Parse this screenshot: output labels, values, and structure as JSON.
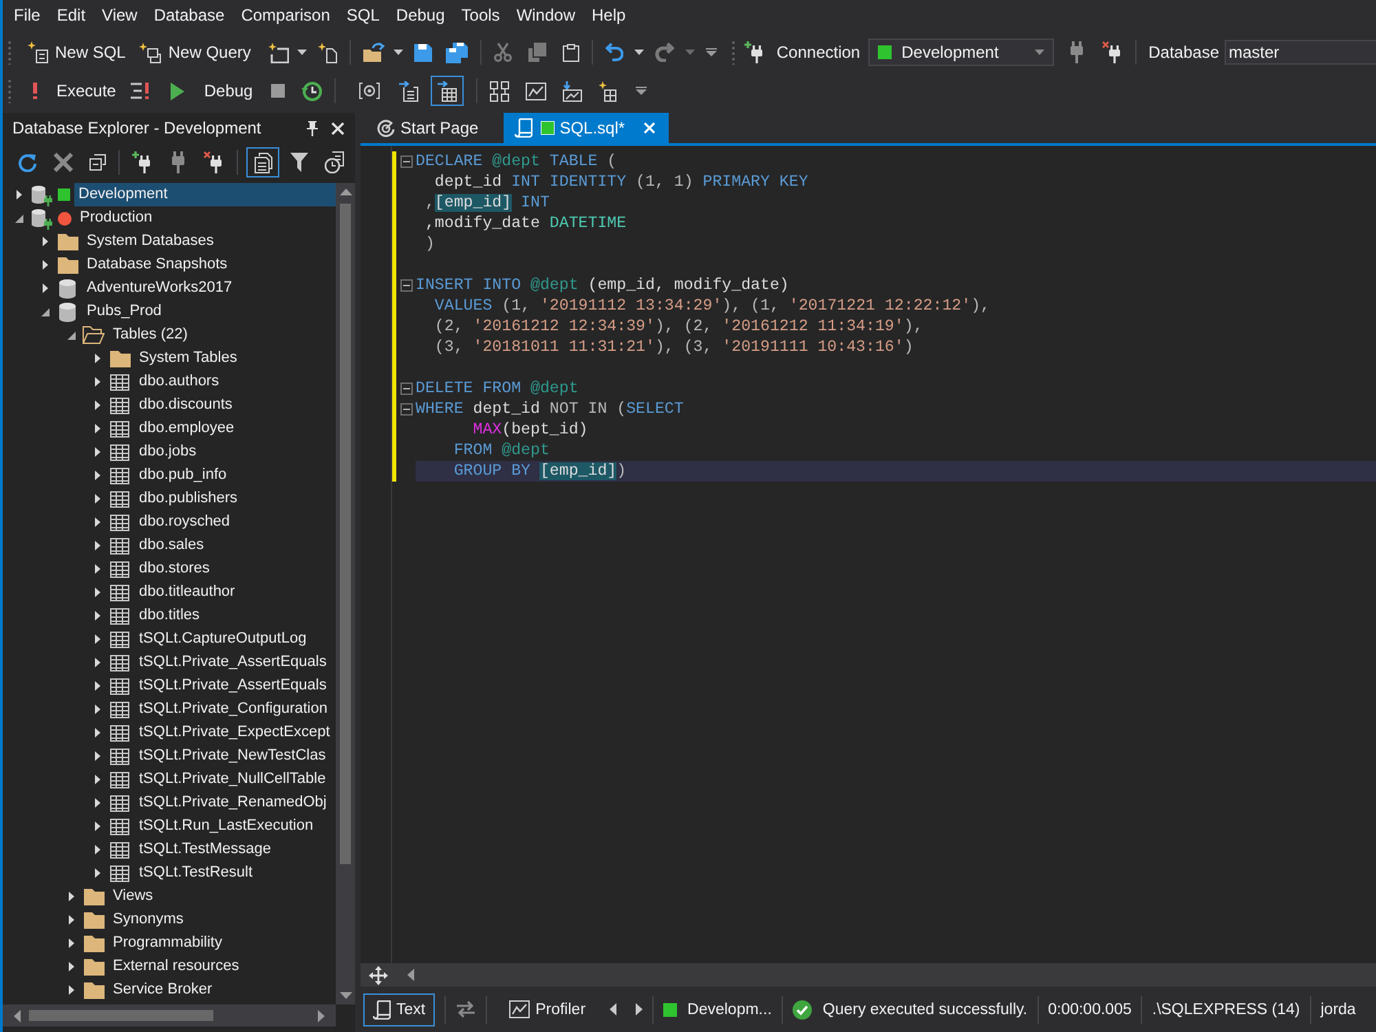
{
  "menu": [
    "File",
    "Edit",
    "View",
    "Database",
    "Comparison",
    "SQL",
    "Debug",
    "Tools",
    "Window",
    "Help"
  ],
  "toolbar_main": {
    "new_sql": "New SQL",
    "new_query": "New Query",
    "cut": {
      "disabled": true
    },
    "copy": {
      "disabled": true
    },
    "undo": {
      "disabled": false
    },
    "redo": {
      "disabled": true
    },
    "connection_label": "Connection",
    "connection": {
      "value": "Development",
      "color": "#2fc42f"
    },
    "database_label": "Database",
    "database": {
      "value": "master"
    }
  },
  "toolbar_query": {
    "execute": "Execute",
    "debug": "Debug",
    "view_toggles": [
      {
        "pressed": false
      },
      {
        "pressed": false
      },
      {
        "pressed": true
      }
    ]
  },
  "explorer": {
    "title": "Database Explorer - Development",
    "toolbar_toggle": {
      "pressed": true
    },
    "tree": [
      {
        "label": "Development",
        "kind": "server",
        "status_dot": false,
        "color": "#2fc42f",
        "expanded": false,
        "selected": true
      },
      {
        "label": "Production",
        "kind": "server",
        "status_dot": true,
        "color": "#f2553f",
        "expanded": true,
        "selected": false,
        "children": [
          {
            "label": "System Databases",
            "kind": "folder",
            "expanded": false,
            "selected": false
          },
          {
            "label": "Database Snapshots",
            "kind": "folder",
            "expanded": false,
            "selected": false
          },
          {
            "label": "AdventureWorks2017",
            "kind": "database",
            "expanded": false,
            "selected": false
          },
          {
            "label": "Pubs_Prod",
            "kind": "database",
            "expanded": true,
            "selected": false,
            "children": [
              {
                "label": "Tables (22)",
                "kind": "folder",
                "expanded": true,
                "selected": false,
                "children": [
                  {
                    "label": "System Tables",
                    "kind": "folder",
                    "expanded": false,
                    "selected": false
                  },
                  {
                    "label": "dbo.authors",
                    "kind": "table",
                    "expanded": false,
                    "selected": false
                  },
                  {
                    "label": "dbo.discounts",
                    "kind": "table",
                    "expanded": false,
                    "selected": false
                  },
                  {
                    "label": "dbo.employee",
                    "kind": "table",
                    "expanded": false,
                    "selected": false
                  },
                  {
                    "label": "dbo.jobs",
                    "kind": "table",
                    "expanded": false,
                    "selected": false
                  },
                  {
                    "label": "dbo.pub_info",
                    "kind": "table",
                    "expanded": false,
                    "selected": false
                  },
                  {
                    "label": "dbo.publishers",
                    "kind": "table",
                    "expanded": false,
                    "selected": false
                  },
                  {
                    "label": "dbo.roysched",
                    "kind": "table",
                    "expanded": false,
                    "selected": false
                  },
                  {
                    "label": "dbo.sales",
                    "kind": "table",
                    "expanded": false,
                    "selected": false
                  },
                  {
                    "label": "dbo.stores",
                    "kind": "table",
                    "expanded": false,
                    "selected": false
                  },
                  {
                    "label": "dbo.titleauthor",
                    "kind": "table",
                    "expanded": false,
                    "selected": false
                  },
                  {
                    "label": "dbo.titles",
                    "kind": "table",
                    "expanded": false,
                    "selected": false
                  },
                  {
                    "label": "tSQLt.CaptureOutputLog",
                    "kind": "table",
                    "expanded": false,
                    "selected": false
                  },
                  {
                    "label": "tSQLt.Private_AssertEquals",
                    "kind": "table",
                    "expanded": false,
                    "selected": false
                  },
                  {
                    "label": "tSQLt.Private_AssertEquals",
                    "kind": "table",
                    "expanded": false,
                    "selected": false
                  },
                  {
                    "label": "tSQLt.Private_Configuration",
                    "kind": "table",
                    "expanded": false,
                    "selected": false
                  },
                  {
                    "label": "tSQLt.Private_ExpectExcept",
                    "kind": "table",
                    "expanded": false,
                    "selected": false
                  },
                  {
                    "label": "tSQLt.Private_NewTestClas",
                    "kind": "table",
                    "expanded": false,
                    "selected": false
                  },
                  {
                    "label": "tSQLt.Private_NullCellTable",
                    "kind": "table",
                    "expanded": false,
                    "selected": false
                  },
                  {
                    "label": "tSQLt.Private_RenamedObj",
                    "kind": "table",
                    "expanded": false,
                    "selected": false
                  },
                  {
                    "label": "tSQLt.Run_LastExecution",
                    "kind": "table",
                    "expanded": false,
                    "selected": false
                  },
                  {
                    "label": "tSQLt.TestMessage",
                    "kind": "table",
                    "expanded": false,
                    "selected": false
                  },
                  {
                    "label": "tSQLt.TestResult",
                    "kind": "table",
                    "expanded": false,
                    "selected": false
                  }
                ]
              },
              {
                "label": "Views",
                "kind": "folder",
                "expanded": false,
                "selected": false
              },
              {
                "label": "Synonyms",
                "kind": "folder",
                "expanded": false,
                "selected": false
              },
              {
                "label": "Programmability",
                "kind": "folder",
                "expanded": false,
                "selected": false
              },
              {
                "label": "External resources",
                "kind": "folder",
                "expanded": false,
                "selected": false
              },
              {
                "label": "Service Broker",
                "kind": "folder",
                "expanded": false,
                "selected": false
              }
            ]
          }
        ]
      }
    ]
  },
  "editor": {
    "tabs": [
      {
        "label": "Start Page",
        "kind": "start",
        "selected": false
      },
      {
        "label": "SQL.sql*",
        "kind": "sql",
        "selected": true,
        "color": "#2fc42f"
      }
    ],
    "lines": [
      {
        "changed": true,
        "fold": true,
        "current": false,
        "tokens": [
          {
            "text": "DECLARE ",
            "kind": "keyword"
          },
          {
            "text": "@dept ",
            "kind": "variable"
          },
          {
            "text": "TABLE",
            "kind": "keyword"
          },
          {
            "text": " (",
            "kind": "punct"
          }
        ]
      },
      {
        "changed": true,
        "fold": false,
        "current": false,
        "tokens": [
          {
            "text": "  dept_id ",
            "kind": "plain"
          },
          {
            "text": "INT IDENTITY",
            "kind": "keyword"
          },
          {
            "text": " (1, 1) ",
            "kind": "punct"
          },
          {
            "text": "PRIMARY KEY",
            "kind": "keyword"
          }
        ]
      },
      {
        "changed": true,
        "fold": false,
        "current": false,
        "tokens": [
          {
            "text": " ,",
            "kind": "punct"
          },
          {
            "text": "[emp_id]",
            "kind": "match"
          },
          {
            "text": " INT",
            "kind": "keyword"
          }
        ]
      },
      {
        "changed": true,
        "fold": false,
        "current": false,
        "tokens": [
          {
            "text": " ,modify_date ",
            "kind": "plain"
          },
          {
            "text": "DATETIME",
            "kind": "type"
          }
        ]
      },
      {
        "changed": true,
        "fold": false,
        "current": false,
        "tokens": [
          {
            "text": " )",
            "kind": "punct"
          }
        ]
      },
      {
        "changed": true,
        "fold": false,
        "current": false
      },
      {
        "changed": true,
        "fold": true,
        "current": false,
        "tokens": [
          {
            "text": "INSERT INTO ",
            "kind": "keyword"
          },
          {
            "text": "@dept",
            "kind": "variable"
          },
          {
            "text": " (emp_id, modify_date)",
            "kind": "plain"
          }
        ]
      },
      {
        "changed": true,
        "fold": false,
        "current": false,
        "tokens": [
          {
            "text": "  VALUES",
            "kind": "keyword"
          },
          {
            "text": " (1, ",
            "kind": "punct"
          },
          {
            "text": "'20191112 13:34:29'",
            "kind": "string"
          },
          {
            "text": "), (1, ",
            "kind": "punct"
          },
          {
            "text": "'20171221 12:22:12'",
            "kind": "string"
          },
          {
            "text": "),",
            "kind": "punct"
          }
        ]
      },
      {
        "changed": true,
        "fold": false,
        "current": false,
        "tokens": [
          {
            "text": "  (2, ",
            "kind": "punct"
          },
          {
            "text": "'20161212 12:34:39'",
            "kind": "string"
          },
          {
            "text": "), (2, ",
            "kind": "punct"
          },
          {
            "text": "'20161212 11:34:19'",
            "kind": "string"
          },
          {
            "text": "),",
            "kind": "punct"
          }
        ]
      },
      {
        "changed": true,
        "fold": false,
        "current": false,
        "tokens": [
          {
            "text": "  (3, ",
            "kind": "punct"
          },
          {
            "text": "'20181011 11:31:21'",
            "kind": "string"
          },
          {
            "text": "), (3, ",
            "kind": "punct"
          },
          {
            "text": "'20191111 10:43:16'",
            "kind": "string"
          },
          {
            "text": ")",
            "kind": "punct"
          }
        ]
      },
      {
        "changed": true,
        "fold": false,
        "current": false
      },
      {
        "changed": true,
        "fold": true,
        "current": false,
        "tokens": [
          {
            "text": "DELETE FROM ",
            "kind": "keyword"
          },
          {
            "text": "@dept",
            "kind": "variable"
          }
        ]
      },
      {
        "changed": true,
        "fold": true,
        "current": false,
        "tokens": [
          {
            "text": "WHERE",
            "kind": "keyword"
          },
          {
            "text": " dept_id ",
            "kind": "plain"
          },
          {
            "text": "NOT IN (",
            "kind": "punct"
          },
          {
            "text": "SELECT",
            "kind": "keyword"
          }
        ]
      },
      {
        "changed": true,
        "fold": false,
        "current": false,
        "tokens": [
          {
            "text": "      MAX",
            "kind": "function"
          },
          {
            "text": "(bept_id)",
            "kind": "plain"
          }
        ]
      },
      {
        "changed": true,
        "fold": false,
        "current": false,
        "tokens": [
          {
            "text": "    FROM ",
            "kind": "keyword"
          },
          {
            "text": "@dept",
            "kind": "variable"
          }
        ]
      },
      {
        "changed": true,
        "fold": false,
        "current": true,
        "tokens": [
          {
            "text": "    GROUP BY ",
            "kind": "keyword"
          },
          {
            "text": "[emp_id]",
            "kind": "match"
          },
          {
            "text": ")",
            "kind": "punct"
          }
        ]
      }
    ]
  },
  "status_bar": {
    "text_button": {
      "label": "Text",
      "pressed": true
    },
    "profiler": "Profiler",
    "connection": {
      "label": "Developm...",
      "color": "#2fc42f"
    },
    "message": "Query executed successfully.",
    "elapsed": "0:00:00.005",
    "server": ".\\SQLEXPRESS (14)",
    "user": "jorda"
  }
}
